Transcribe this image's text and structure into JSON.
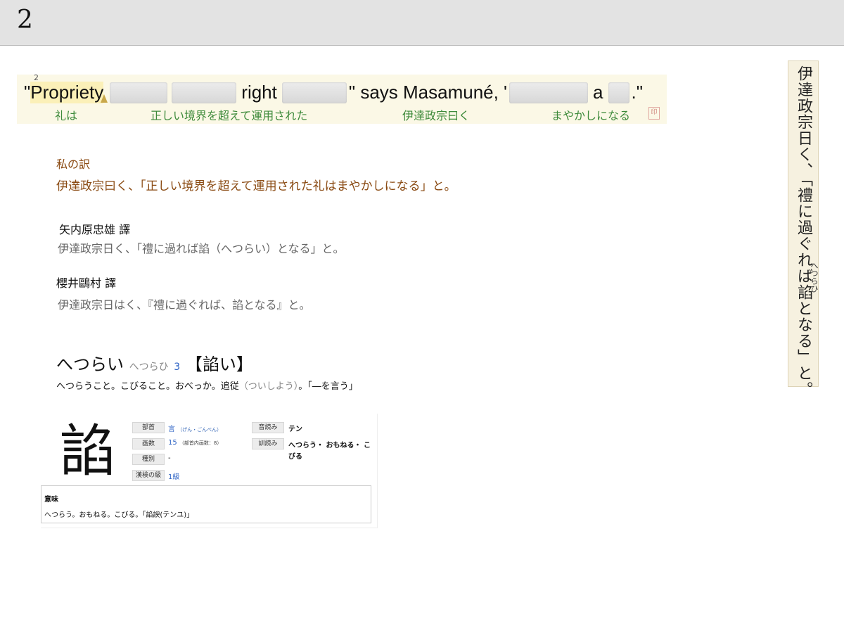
{
  "page": {
    "number": "2"
  },
  "sentence": {
    "footnote": "2",
    "en_open": "\"",
    "en_w1": "Propriety",
    "en_right": "right",
    "en_says": "\" says Masamuné, '",
    "en_a": "a",
    "en_close": ".\"",
    "gloss": [
      "礼は",
      "正しい境界を超えて運用された",
      "伊達政宗曰く",
      "まやかしになる"
    ]
  },
  "my_translation": {
    "label": "私の訳",
    "text": "伊達政宗曰く、「正しい境界を超えて運用された礼はまやかしになる」と。"
  },
  "translations": [
    {
      "translator": "矢内原忠雄 譯",
      "text": "伊達政宗日く、「禮に過れば諂（へつらい）となる」と。"
    },
    {
      "translator": "櫻井鷗村 譯",
      "text": "伊達政宗日はく、『禮に過ぐれば、諂となる』と。"
    }
  ],
  "dictionary": {
    "headword": "へつらい",
    "reading": "へつらひ",
    "accent": "3",
    "kanji_form": "【諂い】",
    "definition_a": "へつらうこと。こびること。おべっか。追従",
    "definition_reading": "（ついしよう）",
    "definition_b": "。「―を言う」"
  },
  "kanji_card": {
    "kanji": "諂",
    "radical_label": "部首",
    "radical_value": "言",
    "radical_note": "（げん・ごんべん）",
    "strokes_label": "画数",
    "strokes_value": "15",
    "strokes_note": "（部首内画数：8）",
    "type_label": "種別",
    "type_value": "-",
    "kanken_label": "漢検の級",
    "kanken_value": "1級",
    "on_label": "音読み",
    "on_value": "テン",
    "kun_label": "訓読み",
    "kun_value_1": "へつらう・ おもねる・ こ",
    "kun_value_2": "びる",
    "meaning_title": "意味",
    "meaning_text": "へつらう。おもねる。こびる。「諂諛(テンユ)」"
  },
  "scan": {
    "text": "伊達政宗日く、「禮に過ぐれば諂となる」と。",
    "ruby": "へつらひ"
  }
}
